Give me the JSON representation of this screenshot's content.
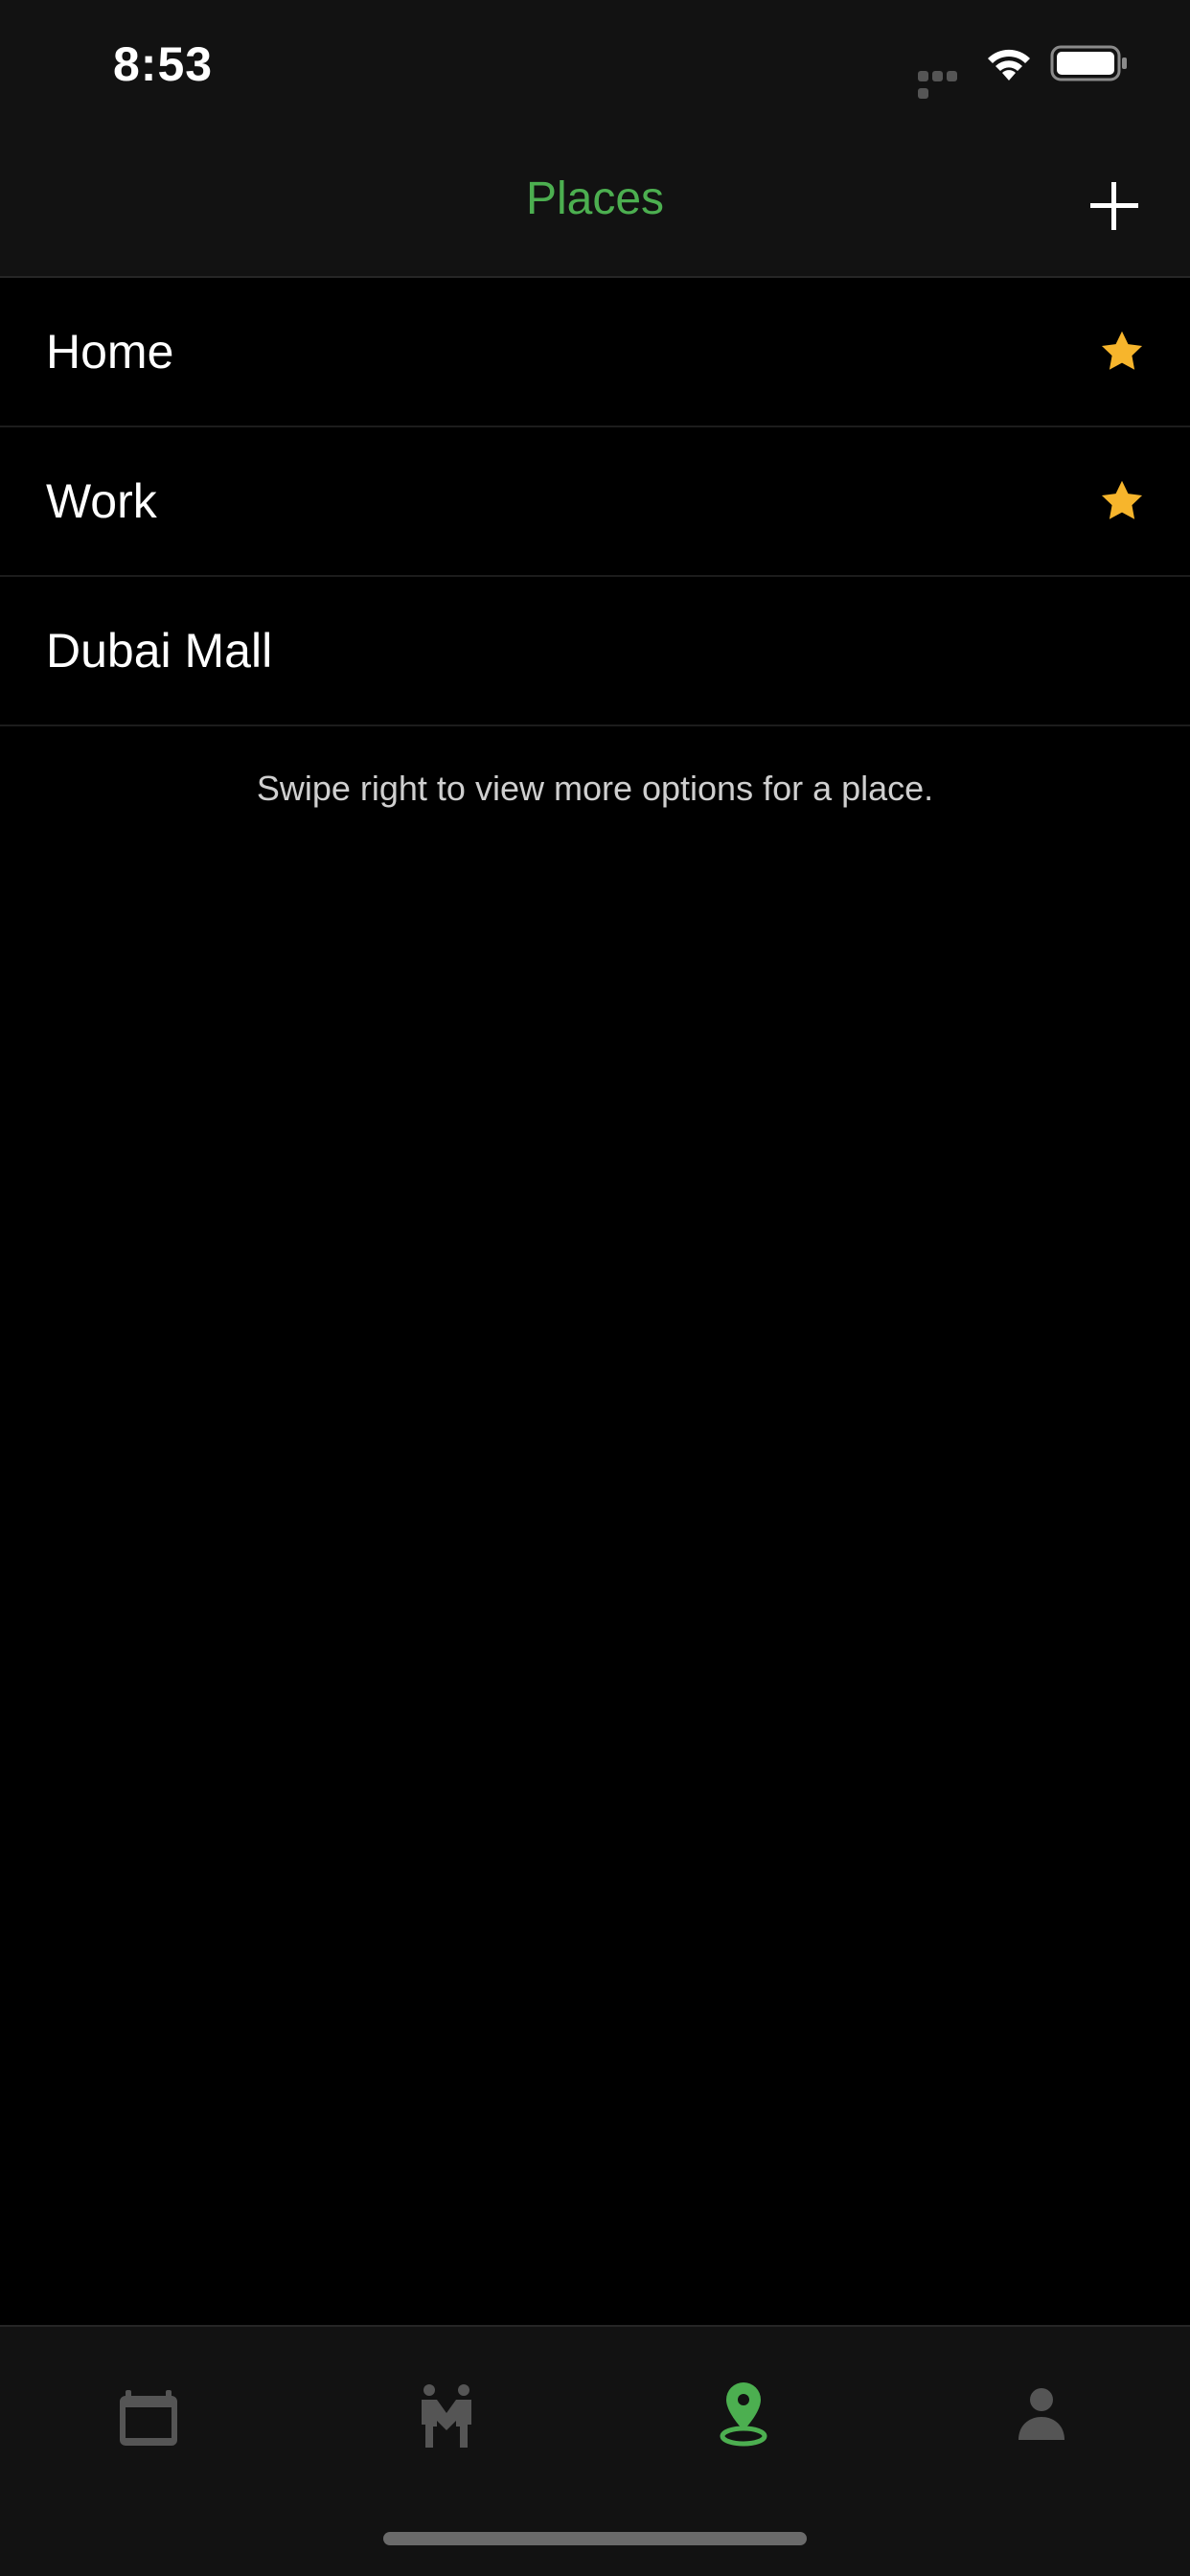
{
  "status_bar": {
    "time": "8:53"
  },
  "nav": {
    "title": "Places",
    "title_color": "#4caf50",
    "add_icon": "plus-icon"
  },
  "places": [
    {
      "name": "Home",
      "favorite": true
    },
    {
      "name": "Work",
      "favorite": true
    },
    {
      "name": "Dubai Mall",
      "favorite": false
    }
  ],
  "hint": "Swipe right to view more options for a place.",
  "star_color": "#f7b52c",
  "tabs": [
    {
      "icon": "calendar-icon",
      "active": false
    },
    {
      "icon": "people-icon",
      "active": false
    },
    {
      "icon": "location-pin-icon",
      "active": true
    },
    {
      "icon": "person-icon",
      "active": false
    }
  ],
  "colors": {
    "active_tab": "#4caf50",
    "inactive_tab": "#555555"
  }
}
